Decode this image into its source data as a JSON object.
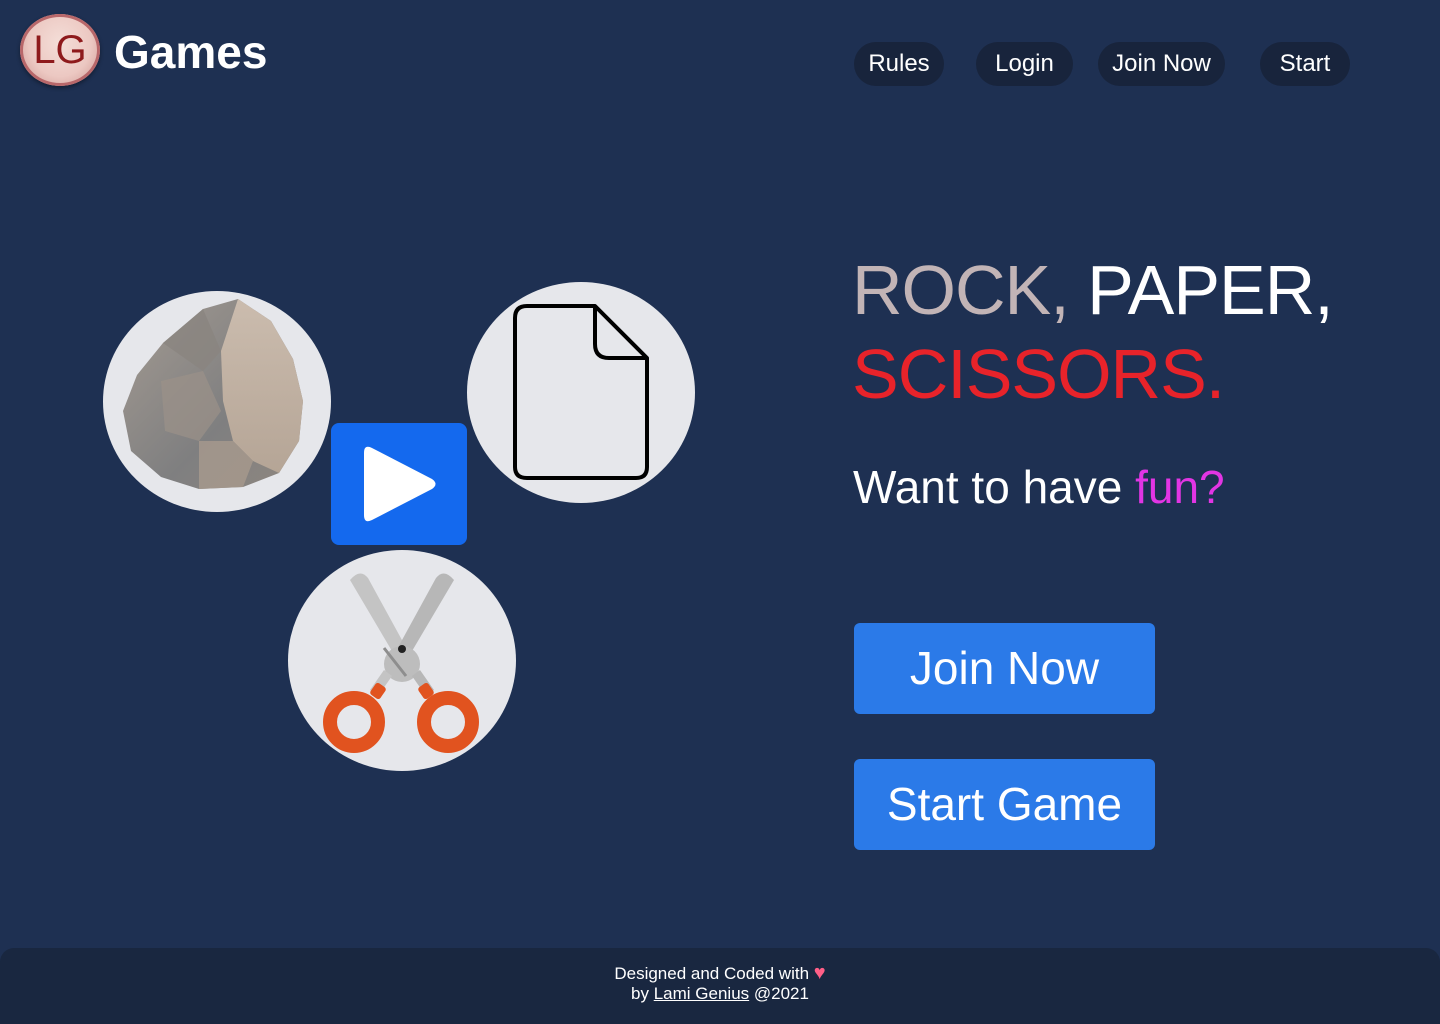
{
  "header": {
    "logo_text": "LG",
    "brand": "Games",
    "nav": [
      {
        "label": "Rules"
      },
      {
        "label": "Login"
      },
      {
        "label": "Join Now"
      },
      {
        "label": "Start"
      }
    ],
    "nav_bg": "#18243c"
  },
  "icons": {
    "rock": "rock-icon",
    "paper": "paper-icon",
    "scissors": "scissors-icon",
    "play": "play-icon"
  },
  "hero": {
    "title_rock": "ROCK,",
    "title_paper": "PAPER,",
    "title_scissors": "SCISSORS.",
    "tagline_prefix": "Want to have ",
    "tagline_highlight": "fun?",
    "join_label": "Join Now",
    "start_label": "Start Game"
  },
  "footer": {
    "line1": "Designed and Coded with",
    "heart": "♥",
    "by": "by",
    "author": "Lami Genius",
    "year": "@2021"
  },
  "colors": {
    "background": "#1e3052",
    "rock_word": "#c2b4b6",
    "scissors_word": "#e8232a",
    "fun_word": "#e235e4",
    "cta": "#2b7ae8",
    "play_button": "#1469ee",
    "footer_bg": "#192740"
  }
}
